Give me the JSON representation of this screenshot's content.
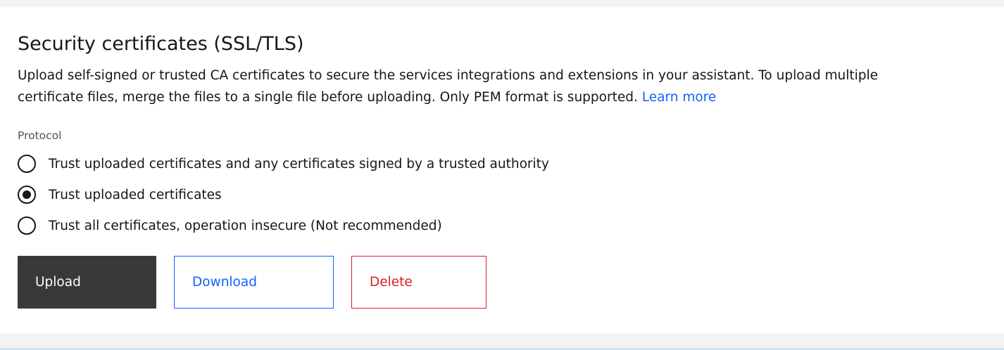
{
  "section": {
    "title": "Security certificates (SSL/TLS)",
    "description": "Upload self-signed or trusted CA certificates to secure the services  integrations and extensions in your assistant. To upload multiple certificate files, merge the files to a single file before uploading. Only PEM format is supported.",
    "learn_more": "Learn more"
  },
  "protocol": {
    "legend": "Protocol",
    "selected_index": 1,
    "options": [
      {
        "label": "Trust uploaded certificates and any certificates signed by a trusted authority",
        "selected": false
      },
      {
        "label": "Trust uploaded certificates",
        "selected": true
      },
      {
        "label": "Trust all certificates, operation insecure (Not recommended)",
        "selected": false
      }
    ]
  },
  "actions": {
    "upload_label": "Upload",
    "download_label": "Download",
    "delete_label": "Delete"
  },
  "colors": {
    "primary_button": "#393939",
    "link": "#0f62fe",
    "danger": "#da1e28",
    "page_background": "#f4f4f4"
  }
}
